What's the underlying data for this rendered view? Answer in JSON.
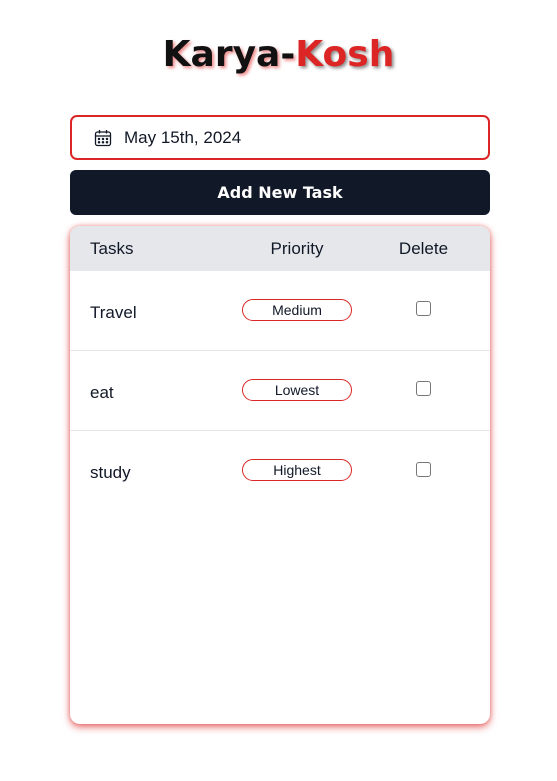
{
  "app": {
    "title_part1": "Karya-",
    "title_part2": "Kosh"
  },
  "date_picker": {
    "value": "May 15th, 2024",
    "icon": "calendar-icon"
  },
  "add_button": {
    "label": "Add New Task"
  },
  "table": {
    "headers": {
      "tasks": "Tasks",
      "priority": "Priority",
      "delete": "Delete"
    },
    "rows": [
      {
        "task": "Travel",
        "priority": "Medium",
        "checked": false
      },
      {
        "task": "eat",
        "priority": "Lowest",
        "checked": false
      },
      {
        "task": "study",
        "priority": "Highest",
        "checked": false
      }
    ]
  },
  "colors": {
    "accent": "#dc2626",
    "button_bg": "#111827",
    "header_bg": "#e5e7eb"
  }
}
